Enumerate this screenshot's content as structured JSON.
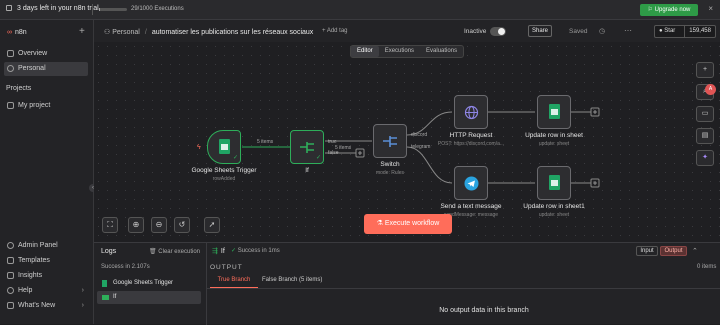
{
  "banner": {
    "trial_text": "3 days left in your n8n trial",
    "executions": "29/1000 Executions",
    "executions_used": 29,
    "executions_limit": 1000,
    "upgrade_label": "Upgrade now"
  },
  "sidebar": {
    "brand": "n8n",
    "items": [
      {
        "label": "Overview"
      },
      {
        "label": "Personal"
      }
    ],
    "projects_heading": "Projects",
    "project": "My project",
    "bottom": [
      {
        "label": "Admin Panel"
      },
      {
        "label": "Templates"
      },
      {
        "label": "Insights"
      },
      {
        "label": "Help"
      },
      {
        "label": "What's New"
      }
    ]
  },
  "header": {
    "crumb_parent": "Personal",
    "workflow_name": "automatiser les publications sur les réseaux sociaux",
    "add_tag": "+ Add tag",
    "status": "Inactive",
    "share": "Share",
    "saved": "Saved",
    "star_label": "Star",
    "star_count": "159,458"
  },
  "canvas": {
    "tabs": [
      "Editor",
      "Executions",
      "Evaluations"
    ],
    "nodes": {
      "trigger": {
        "title": "Google Sheets Trigger",
        "sub": "rowAdded"
      },
      "if": {
        "title": "If"
      },
      "switch": {
        "title": "Switch",
        "sub": "mode: Rules"
      },
      "http": {
        "title": "HTTP Request",
        "sub": "POST: https://discord.com/a..."
      },
      "update1": {
        "title": "Update row in sheet",
        "sub": "update: sheet"
      },
      "telegram": {
        "title": "Send a text message",
        "sub": "sendMessage: message"
      },
      "update2": {
        "title": "Update row in sheet1",
        "sub": "update: sheet"
      }
    },
    "edge_label": "5 items",
    "if_true": "true",
    "if_false": "false",
    "if_false_items": "5 items",
    "switch_out1": "discord",
    "switch_out2": "telegram",
    "execute_label": "Execute workflow"
  },
  "logs": {
    "title": "Logs",
    "clear": "Clear execution",
    "summary": "Success in 2.107s",
    "rows": [
      {
        "label": "Google Sheets Trigger"
      },
      {
        "label": "If"
      }
    ],
    "node_name": "If",
    "node_status": "Success in 1ms",
    "input_label": "Input",
    "output_label": "Output",
    "output_heading": "OUTPUT",
    "items_count": "0 items",
    "tab_true": "True Branch",
    "tab_false": "False Branch (5 items)",
    "empty_message": "No output data in this branch"
  },
  "colors": {
    "accent": "#ff6d5a",
    "success": "#2eae5a",
    "upgrade": "#2e9b47"
  }
}
